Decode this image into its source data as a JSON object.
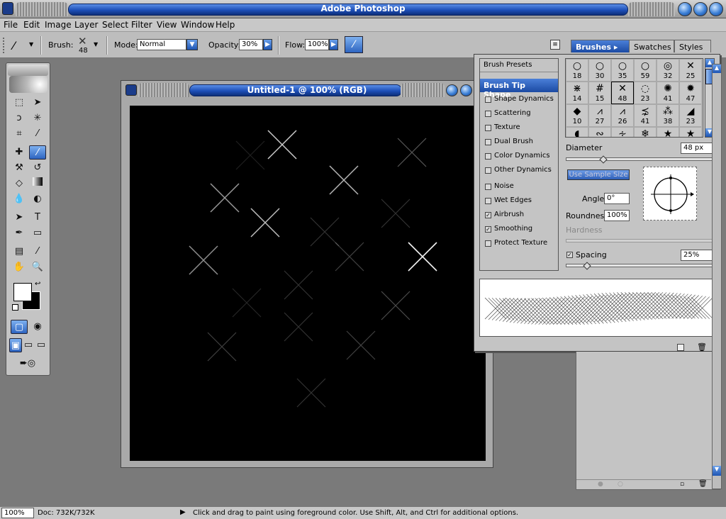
{
  "app": {
    "title": "Adobe Photoshop"
  },
  "menu": [
    "File",
    "Edit",
    "Image",
    "Layer",
    "Select",
    "Filter",
    "View",
    "Window",
    "Help"
  ],
  "options": {
    "brush_label": "Brush:",
    "brush_size": "48",
    "mode_label": "Mode:",
    "mode_value": "Normal",
    "opacity_label": "Opacity:",
    "opacity_value": "30%",
    "flow_label": "Flow:",
    "flow_value": "100%"
  },
  "document": {
    "title": "Untitled-1 @ 100% (RGB)"
  },
  "panel_tabs": [
    "Brushes",
    "Swatches",
    "Styles"
  ],
  "brush_options": {
    "header": "Brush Presets",
    "selected": "Brush Tip Shape",
    "items": [
      {
        "label": "Shape Dynamics",
        "checked": false
      },
      {
        "label": "Scattering",
        "checked": false
      },
      {
        "label": "Texture",
        "checked": false
      },
      {
        "label": "Dual Brush",
        "checked": false
      },
      {
        "label": "Color Dynamics",
        "checked": false
      },
      {
        "label": "Other Dynamics",
        "checked": false
      },
      {
        "label": "Noise",
        "checked": false
      },
      {
        "label": "Wet Edges",
        "checked": false
      },
      {
        "label": "Airbrush",
        "checked": true
      },
      {
        "label": "Smoothing",
        "checked": true
      },
      {
        "label": "Protect Texture",
        "checked": false
      }
    ]
  },
  "brush_grid": [
    [
      "18",
      "30",
      "35",
      "59",
      "32",
      "25"
    ],
    [
      "14",
      "15",
      "48",
      "23",
      "41",
      "47"
    ],
    [
      "10",
      "27",
      "26",
      "41",
      "38",
      "23"
    ]
  ],
  "brush_settings": {
    "diameter_label": "Diameter",
    "diameter_value": "48 px",
    "use_sample_label": "Use Sample Size",
    "angle_label": "Angle:",
    "angle_value": "0°",
    "roundness_label": "Roundness:",
    "roundness_value": "100%",
    "hardness_label": "Hardness",
    "spacing_label": "Spacing",
    "spacing_value": "25%"
  },
  "status": {
    "zoom": "100%",
    "doc": "Doc: 732K/732K",
    "hint": "Click and drag to paint using foreground color.  Use Shift, Alt, and Ctrl for additional options."
  }
}
